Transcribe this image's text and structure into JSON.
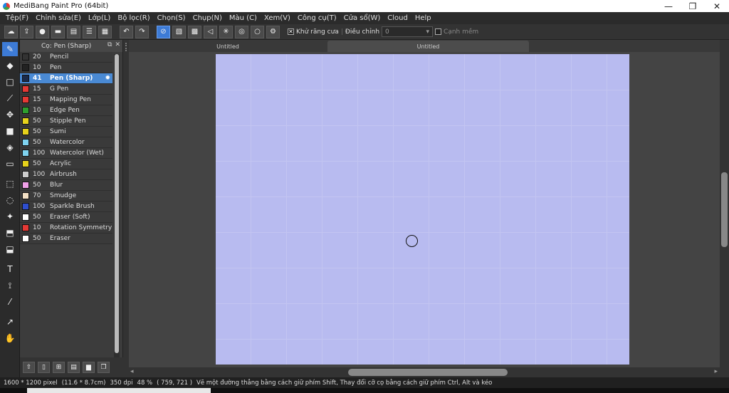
{
  "window": {
    "title": "MediBang Paint Pro (64bit)",
    "minimize": "—",
    "maximize": "❐",
    "close": "✕"
  },
  "menu": [
    "Tệp(F)",
    "Chỉnh sửa(E)",
    "Lớp(L)",
    "Bộ lọc(R)",
    "Chọn(S)",
    "Chụp(N)",
    "Màu (C)",
    "Xem(V)",
    "Công cụ(T)",
    "Cửa sổ(W)",
    "Cloud",
    "Help"
  ],
  "toolbar": {
    "antialias_label": "Khử răng cưa",
    "antialias_checked": "✕",
    "adjust_label": "Điều chỉnh",
    "adjust_value": "0",
    "smooth_label": "Cạnh mềm"
  },
  "brush_panel": {
    "title": "Cọ: Pen (Sharp)",
    "brushes": [
      {
        "size": "20",
        "name": "Pencil",
        "color": "#333333"
      },
      {
        "size": "10",
        "name": "Pen",
        "color": "#222222"
      },
      {
        "size": "41",
        "name": "Pen (Sharp)",
        "color": "#1a2a4a",
        "selected": true
      },
      {
        "size": "15",
        "name": "G Pen",
        "color": "#e53935"
      },
      {
        "size": "15",
        "name": "Mapping Pen",
        "color": "#e53935"
      },
      {
        "size": "10",
        "name": "Edge Pen",
        "color": "#2e9e2e"
      },
      {
        "size": "50",
        "name": "Stipple Pen",
        "color": "#e6d21c"
      },
      {
        "size": "50",
        "name": "Sumi",
        "color": "#e6d21c"
      },
      {
        "size": "50",
        "name": "Watercolor",
        "color": "#7fd3f0"
      },
      {
        "size": "100",
        "name": "Watercolor (Wet)",
        "color": "#7fd3f0"
      },
      {
        "size": "50",
        "name": "Acrylic",
        "color": "#e6d21c"
      },
      {
        "size": "100",
        "name": "Airbrush",
        "color": "#cccccc"
      },
      {
        "size": "50",
        "name": "Blur",
        "color": "#f0a0e8"
      },
      {
        "size": "70",
        "name": "Smudge",
        "color": "#f2dfc4"
      },
      {
        "size": "100",
        "name": "Sparkle Brush",
        "color": "#2e4ecf"
      },
      {
        "size": "50",
        "name": "Eraser (Soft)",
        "color": "#ffffff"
      },
      {
        "size": "10",
        "name": "Rotation Symmetry Pe",
        "color": "#e53935"
      },
      {
        "size": "50",
        "name": "Eraser",
        "color": "#ffffff"
      }
    ]
  },
  "tabs": {
    "first": "Untitled",
    "second": "Untitled"
  },
  "status": {
    "dimensions": "1600 * 1200 pixel",
    "physical": "(11.6 * 8.7cm)",
    "dpi": "350 dpi",
    "zoom": "48 %",
    "coords": "( 759, 721 )",
    "hint": "Vẽ một đường thẳng bằng cách giữ phím Shift, Thay đổi cỡ cọ bằng cách giữ phím Ctrl, Alt và kéo"
  }
}
